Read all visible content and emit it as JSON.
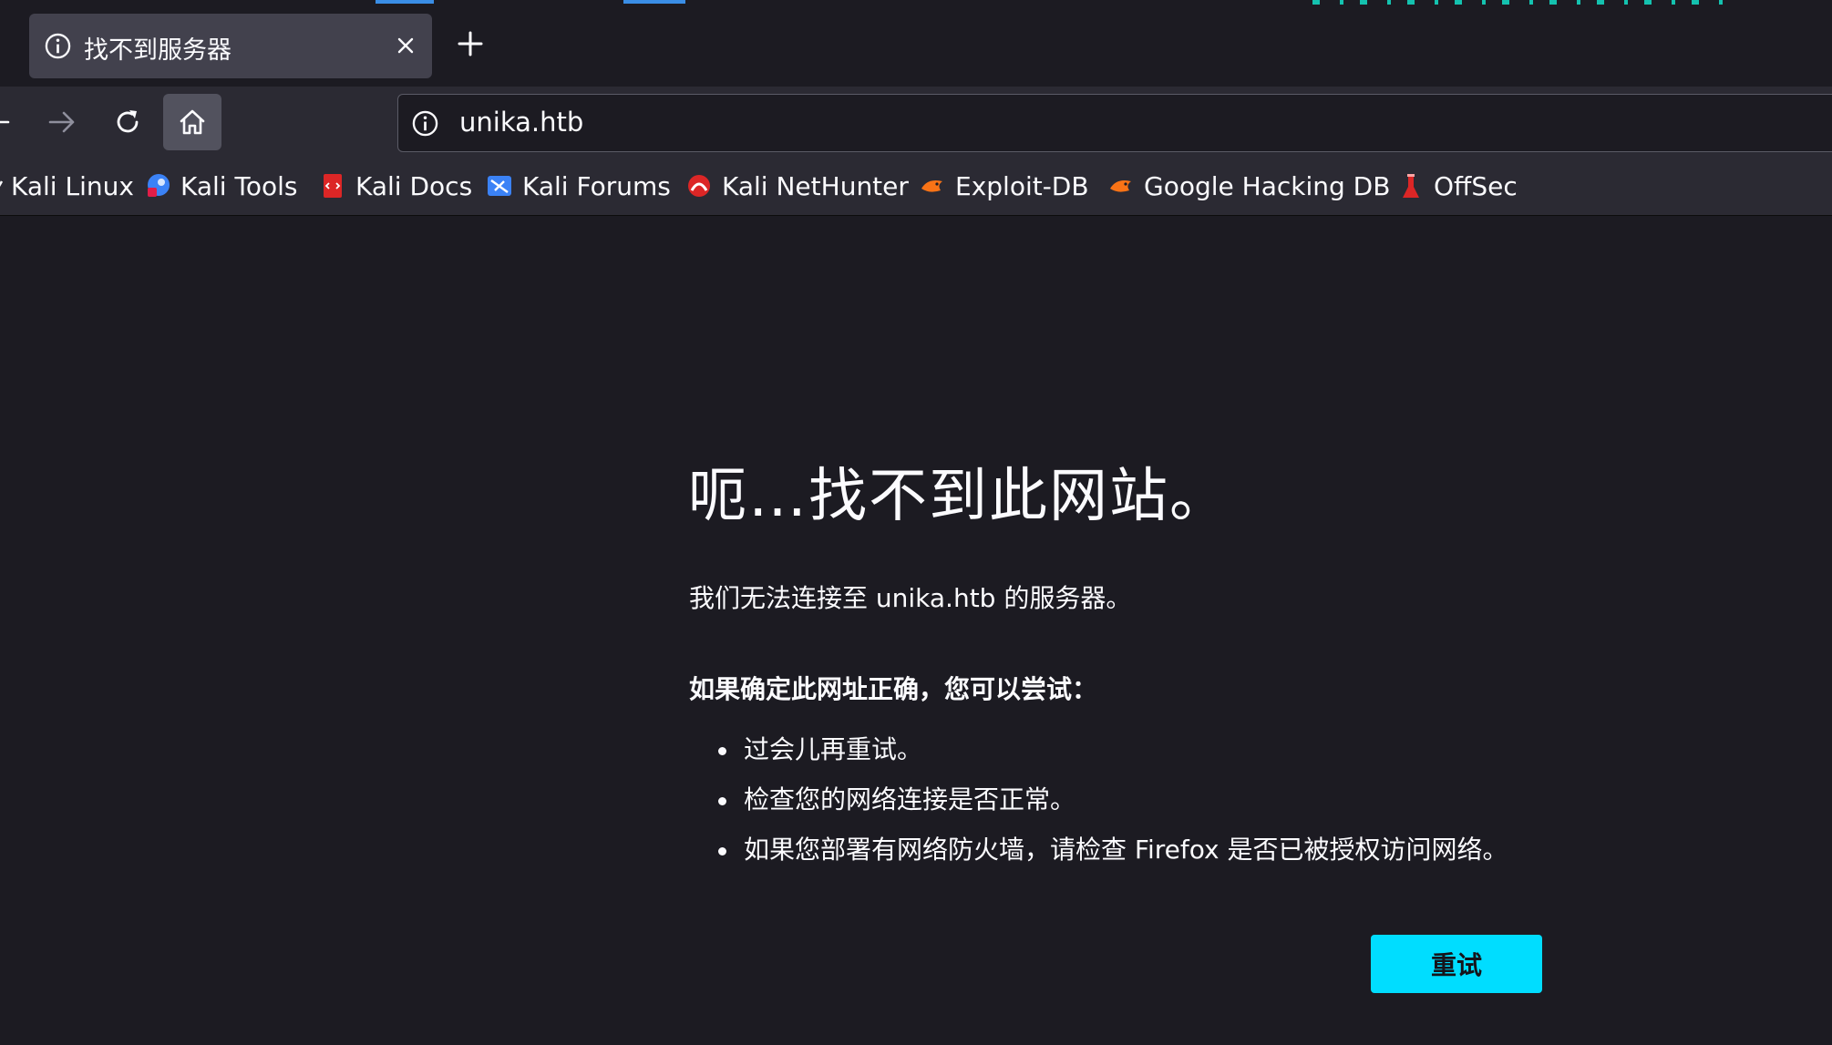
{
  "tab": {
    "title": "找不到服务器"
  },
  "url": {
    "value": "unika.htb"
  },
  "bookmarks": [
    {
      "label": "Kali Linux",
      "icon": "kali-dragon-icon"
    },
    {
      "label": "Kali Tools",
      "icon": "kali-tools-icon"
    },
    {
      "label": "Kali Docs",
      "icon": "kali-docs-icon"
    },
    {
      "label": "Kali Forums",
      "icon": "kali-forums-icon"
    },
    {
      "label": "Kali NetHunter",
      "icon": "kali-nethunter-icon"
    },
    {
      "label": "Exploit-DB",
      "icon": "exploit-db-icon"
    },
    {
      "label": "Google Hacking DB",
      "icon": "ghdb-icon"
    },
    {
      "label": "OffSec",
      "icon": "offsec-icon"
    }
  ],
  "error": {
    "title": "呃…找不到此网站。",
    "description": "我们无法连接至 unika.htb 的服务器。",
    "hint": "如果确定此网址正确，您可以尝试：",
    "suggestions": [
      "过会儿再重试。",
      "检查您的网络连接是否正常。",
      "如果您部署有网络防火墙，请检查 Firefox 是否已被授权访问网络。"
    ],
    "retry_label": "重试"
  },
  "colors": {
    "background": "#1c1b22",
    "toolbar": "#2b2a33",
    "accent": "#00ddff"
  }
}
